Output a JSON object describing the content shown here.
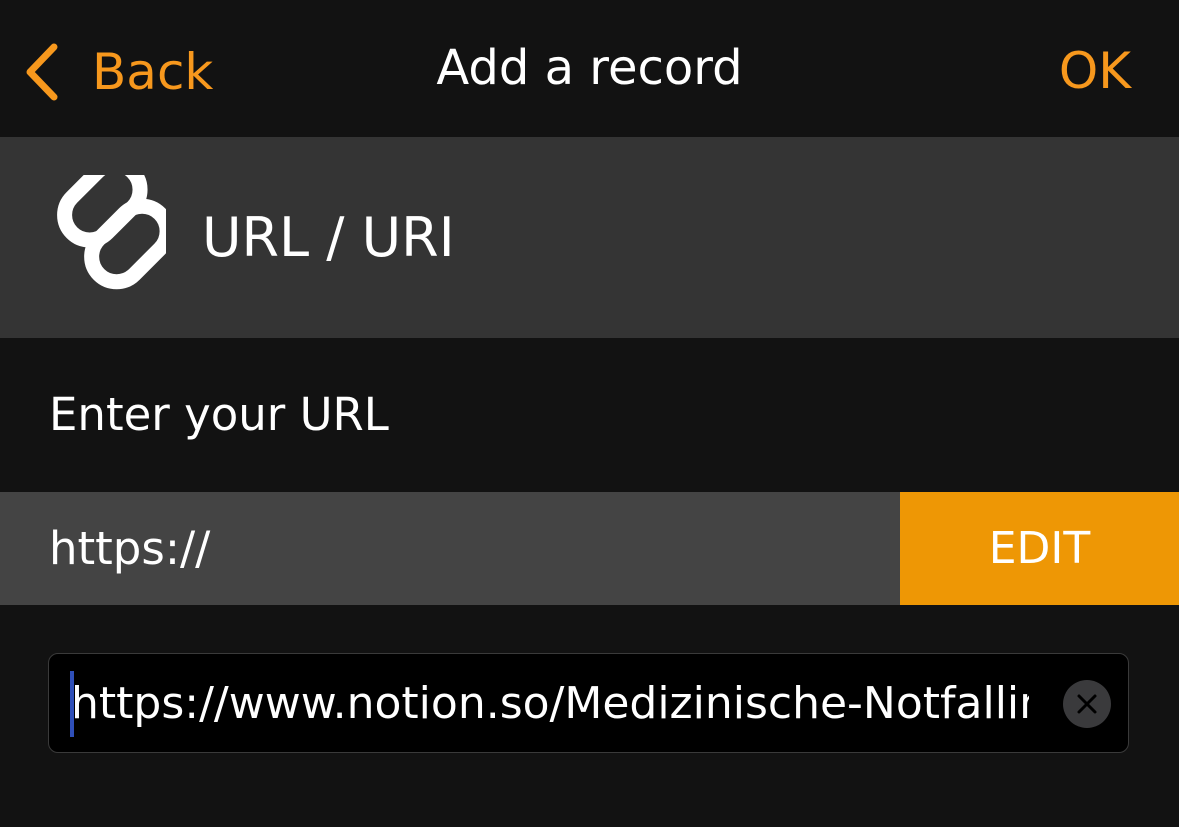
{
  "nav": {
    "back_label": "Back",
    "title": "Add a record",
    "ok_label": "OK"
  },
  "record_type": {
    "icon": "link-icon",
    "label": "URL / URI"
  },
  "prompt": "Enter your URL",
  "scheme": {
    "value": "https://",
    "edit_label": "EDIT"
  },
  "url_field": {
    "value": "https://www.notion.so/Medizinische-Notfallinformationen"
  },
  "colors": {
    "accent": "#F7981D",
    "edit_button": "#EE9705",
    "background": "#121212",
    "header_band": "#343434",
    "scheme_row": "#444444"
  }
}
